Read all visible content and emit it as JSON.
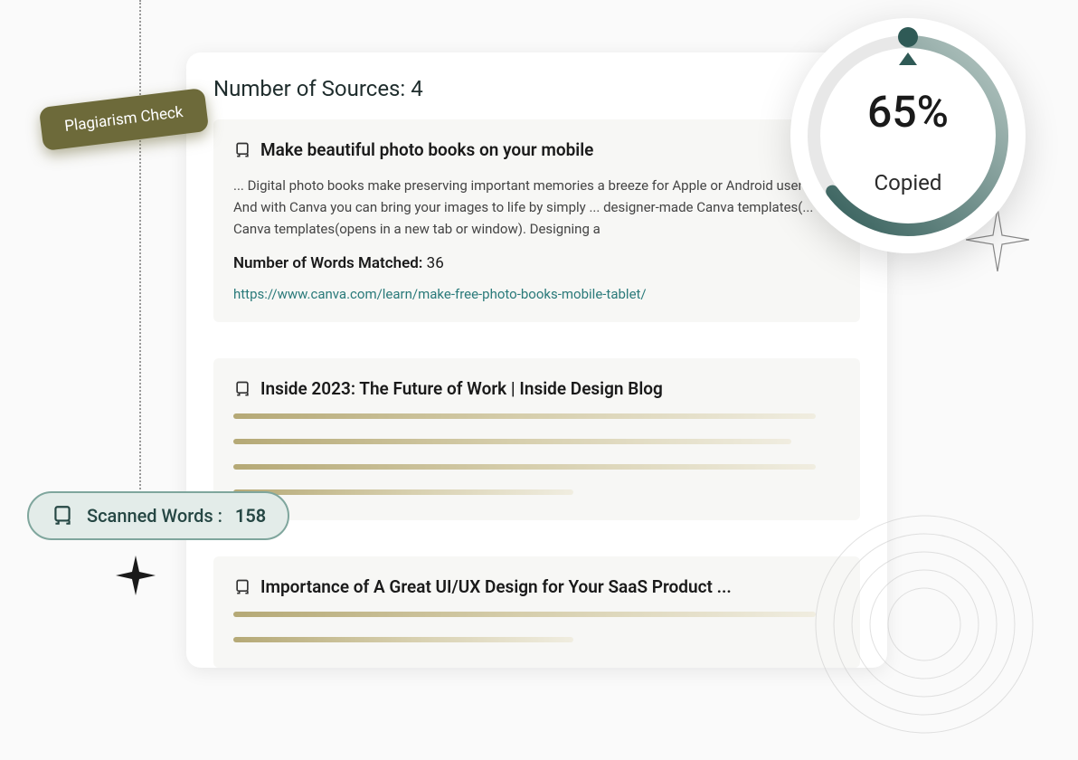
{
  "header": {
    "sources_label": "Number of Sources:",
    "sources_count": "4"
  },
  "sources": [
    {
      "title": "Make beautiful photo books on your mobile",
      "body": "... Digital photo books make preserving important memories a breeze for Apple or Android users. And with Canva you can bring your images to life by simply ... designer-made Canva templates(... Canva templates(opens in a new tab or window). Designing a",
      "matched_label": "Number of Words Matched:",
      "matched_value": "36",
      "url": "https://www.canva.com/learn/make-free-photo-books-mobile-tablet/"
    },
    {
      "title": "Inside 2023: The Future of Work | Inside Design Blog"
    },
    {
      "title": "Importance of A Great UI/UX Design for Your SaaS Product ..."
    }
  ],
  "plagiarism_pill": "Plagiarism Check",
  "scanned": {
    "label": "Scanned Words :",
    "value": "158"
  },
  "gauge": {
    "percent": "65%",
    "label": "Copied"
  }
}
